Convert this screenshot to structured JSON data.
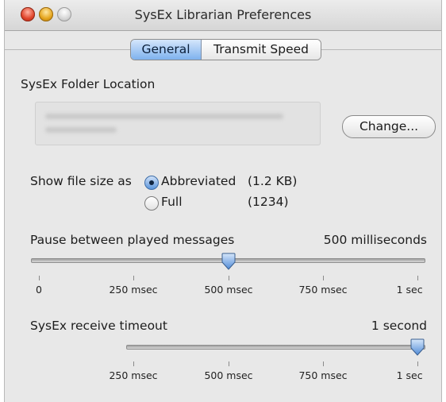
{
  "window": {
    "title": "SysEx Librarian Preferences"
  },
  "tabs": [
    {
      "label": "General",
      "selected": true
    },
    {
      "label": "Transmit Speed",
      "selected": false
    }
  ],
  "folder": {
    "heading": "SysEx Folder Location",
    "change_button": "Change..."
  },
  "file_size": {
    "label": "Show file size as",
    "options": [
      {
        "label": "Abbreviated",
        "example": "(1.2 KB)",
        "selected": true
      },
      {
        "label": "Full",
        "example": "(1234)",
        "selected": false
      }
    ]
  },
  "pause": {
    "label": "Pause between played messages",
    "value_text": "500 milliseconds",
    "value_msec": 500,
    "ticks": [
      "0",
      "250 msec",
      "500 msec",
      "750 msec",
      "1 sec"
    ]
  },
  "timeout": {
    "label": "SysEx receive timeout",
    "value_text": "1 second",
    "value_sec": 1,
    "ticks": [
      "250 msec",
      "500 msec",
      "750 msec",
      "1 sec"
    ]
  },
  "colors": {
    "accent": "#5b95db",
    "window_bg": "#e8e8e8"
  }
}
